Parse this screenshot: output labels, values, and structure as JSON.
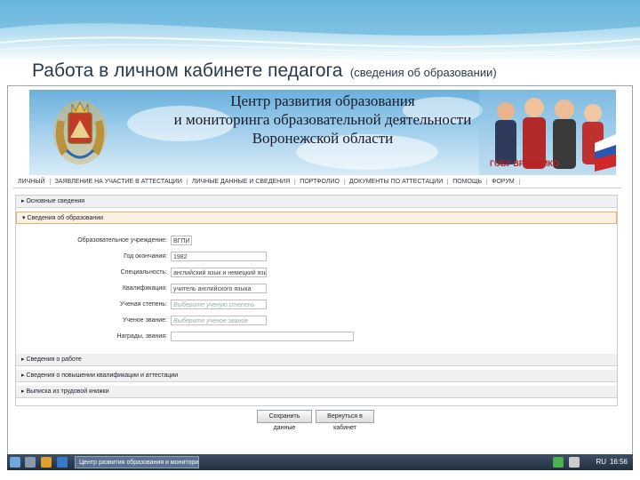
{
  "slide": {
    "title": "Работа в личном кабинете педагога",
    "subtitle": "(сведения об образовании)"
  },
  "banner": {
    "line1": "Центр развития образования",
    "line2": "и мониторинга образовательной деятельности",
    "line3": "Воронежской области",
    "org_label": "ГОБУ ВРЦОиМКО"
  },
  "nav": {
    "items": [
      "ЛИЧНЫЙ",
      "ЗАЯВЛЕНИЕ НА УЧАСТИЕ В АТТЕСТАЦИИ",
      "ЛИЧНЫЕ ДАННЫЕ И СВЕДЕНИЯ",
      "ПОРТФОЛИО",
      "ДОКУМЕНТЫ ПО АТТЕСТАЦИИ",
      "ПОМОЩЬ",
      "ФОРУМ"
    ]
  },
  "sections": {
    "basic": "Основные сведения",
    "education": "Сведения об образовании",
    "work": "Сведения о работе",
    "qualification": "Сведения о повышении квалификации и аттестации",
    "record": "Выписка из трудовой книжки"
  },
  "form": {
    "institution_label": "Образовательное учреждение:",
    "institution_value": "ВГПИ",
    "year_label": "Год окончания:",
    "year_value": "1982",
    "specialty_label": "Специальность:",
    "specialty_value": "английский язык и немецкий язык",
    "qualification_label": "Квалификация:",
    "qualification_value": "учитель английского языка",
    "degree_label": "Ученая степень:",
    "degree_placeholder": "Выберите ученую степень",
    "title_label": "Ученое звание:",
    "title_placeholder": "Выберите ученое звание",
    "awards_label": "Награды, звания:",
    "awards_value": ""
  },
  "buttons": {
    "save": "Сохранить данные",
    "return": "Вернуться в кабинет"
  },
  "taskbar": {
    "window_title": "Центр развития образования и мониторинга",
    "lang": "RU",
    "clock": "16:56"
  }
}
